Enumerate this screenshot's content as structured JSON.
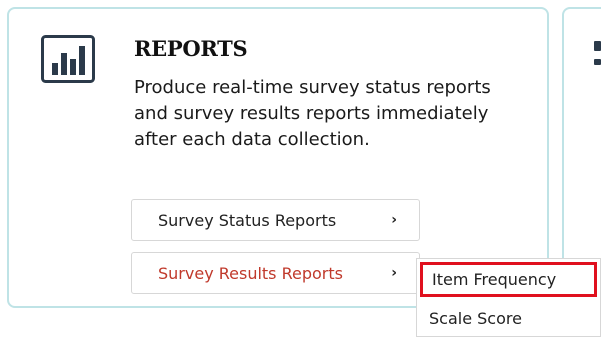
{
  "card": {
    "icon": "bar-chart-icon",
    "title": "REPORTS",
    "description": "Produce real-time survey status reports and survey results reports immediately after each data collection."
  },
  "buttons": {
    "status_label": "Survey Status Reports",
    "results_label": "Survey Results Reports",
    "chevron": "›"
  },
  "dropdown": {
    "items": [
      {
        "label": "Item Frequency"
      },
      {
        "label": "Scale Score"
      }
    ]
  },
  "colors": {
    "card_border": "#bfe3e6",
    "results_text": "#c0392b",
    "highlight_border": "#e0101e",
    "icon_navy": "#2b3a4a"
  }
}
